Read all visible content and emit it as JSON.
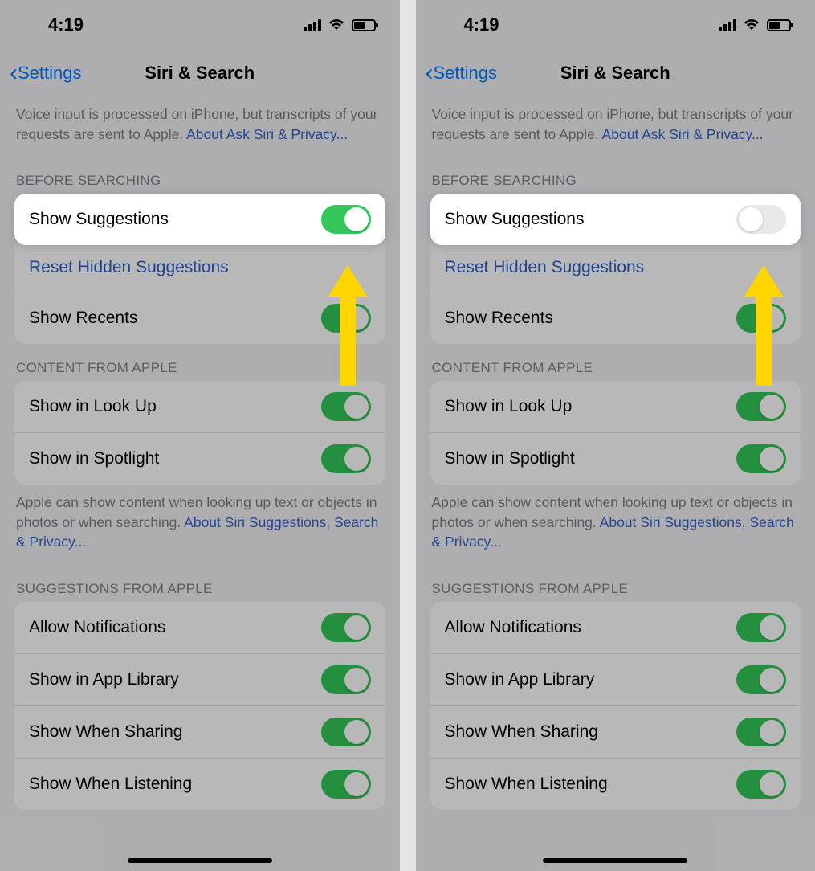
{
  "status": {
    "time": "4:19"
  },
  "nav": {
    "back": "Settings",
    "title": "Siri & Search"
  },
  "desc1_text": "Voice input is processed on iPhone, but transcripts of your requests are sent to Apple. ",
  "desc1_link": "About Ask Siri & Privacy...",
  "section_before": "BEFORE SEARCHING",
  "row_show_suggestions": "Show Suggestions",
  "row_reset_hidden": "Reset Hidden Suggestions",
  "row_show_recents": "Show Recents",
  "section_content": "CONTENT FROM APPLE",
  "row_lookup": "Show in Look Up",
  "row_spotlight": "Show in Spotlight",
  "desc2_text": "Apple can show content when looking up text or objects in photos or when searching. ",
  "desc2_link": "About Siri Suggestions, Search & Privacy...",
  "section_suggestions": "SUGGESTIONS FROM APPLE",
  "row_allow_notif": "Allow Notifications",
  "row_app_library": "Show in App Library",
  "row_sharing": "Show When Sharing",
  "row_listening": "Show When Listening",
  "left_toggle_state": "on",
  "right_toggle_state": "off"
}
